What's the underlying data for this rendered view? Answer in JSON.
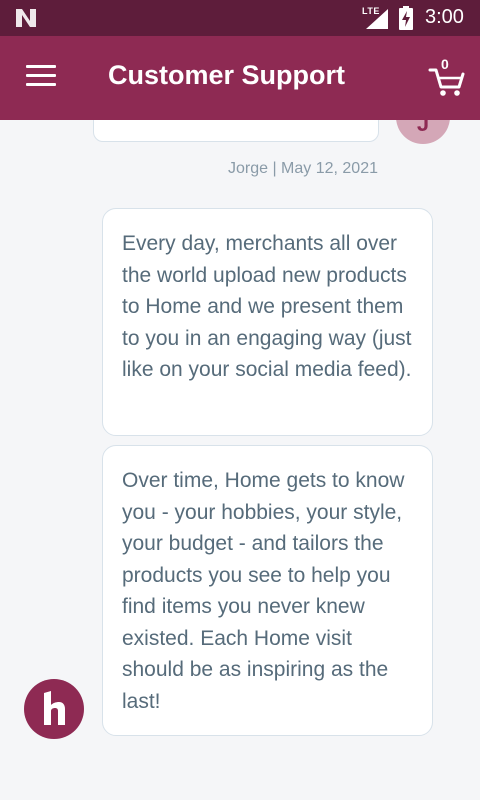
{
  "status_bar": {
    "time": "3:00",
    "network": "LTE"
  },
  "app_bar": {
    "title": "Customer Support",
    "cart_count": "0"
  },
  "chat": {
    "previous_avatar_initial": "J",
    "meta": "Jorge | May 12, 2021",
    "messages": [
      {
        "text": "Every day, merchants all over the world upload new products to Home and we present them to you in an engaging way (just like on your social media feed)."
      },
      {
        "text": "Over time, Home gets to know you - your hobbies, your style, your budget - and tailors the products you see to help you find items you never knew existed. Each Home visit should be as inspiring as the last!"
      }
    ]
  },
  "colors": {
    "status_bar": "#5e1d3b",
    "app_bar": "#8e2a53",
    "background": "#f5f6f8",
    "text": "#566b7a",
    "meta": "#8a9ba8"
  },
  "icons": {
    "status_logo": "n-logo-icon",
    "menu": "menu-icon",
    "cart": "cart-icon",
    "fab": "home-logo-icon"
  }
}
